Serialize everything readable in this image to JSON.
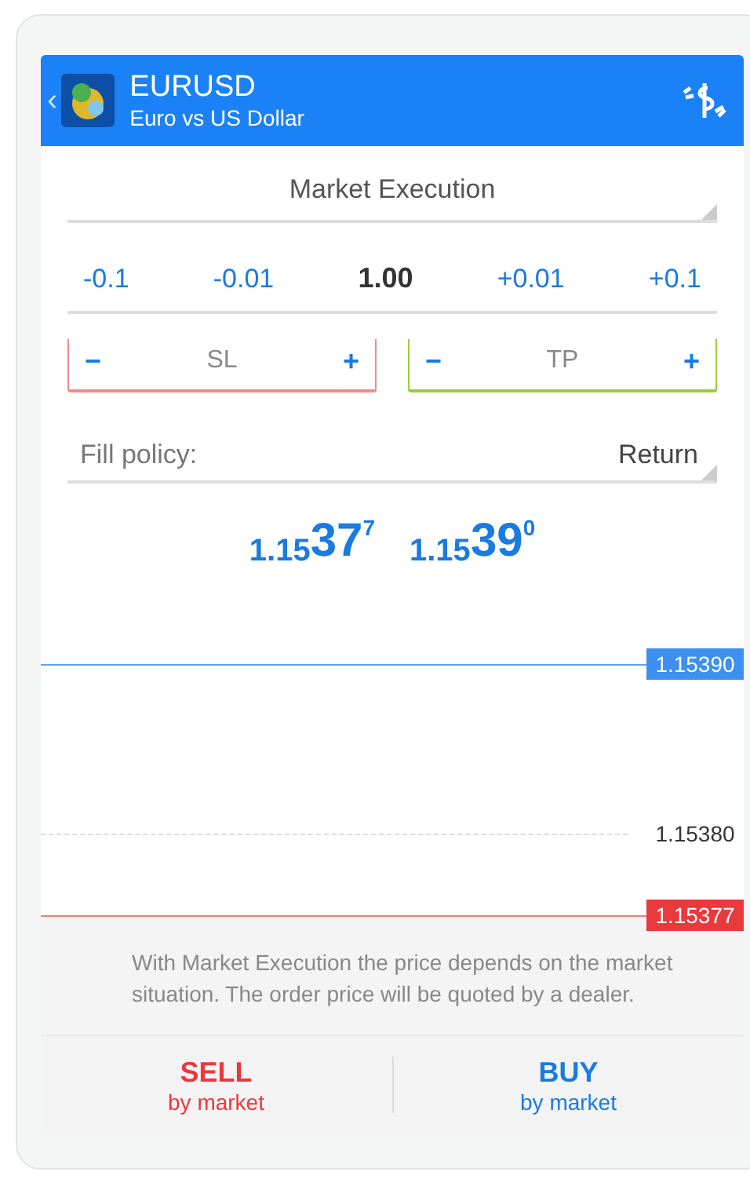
{
  "header": {
    "symbol": "EURUSD",
    "description": "Euro vs US Dollar",
    "back": "‹"
  },
  "execution": {
    "value": "Market Execution"
  },
  "volume": {
    "steps": [
      {
        "label": "-0.1"
      },
      {
        "label": "-0.01"
      }
    ],
    "value": "1.00",
    "steps_up": [
      {
        "label": "+0.01"
      },
      {
        "label": "+0.1"
      }
    ]
  },
  "stops": [
    {
      "label": "SL",
      "minus": "−",
      "plus": "+",
      "color": "#f28b8b"
    },
    {
      "label": "TP",
      "minus": "−",
      "plus": "+",
      "color": "#9bcb3c"
    }
  ],
  "fill_policy": {
    "label": "Fill policy:",
    "value": "Return"
  },
  "quotes": [
    {
      "prefix": "1.15",
      "big": "37",
      "sup": "7"
    },
    {
      "prefix": "1.15",
      "big": "39",
      "sup": "0"
    }
  ],
  "price_lines": [
    {
      "kind": "ask",
      "label": "1.15390"
    },
    {
      "kind": "level",
      "label": "1.15380"
    },
    {
      "kind": "bid",
      "label": "1.15377"
    }
  ],
  "info": "With Market Execution the price depends on the market situation. The order price will be quoted by a dealer.",
  "actions": [
    {
      "kind": "sell",
      "title": "SELL",
      "subtitle": "by market"
    },
    {
      "kind": "buy",
      "title": "BUY",
      "subtitle": "by market"
    }
  ]
}
